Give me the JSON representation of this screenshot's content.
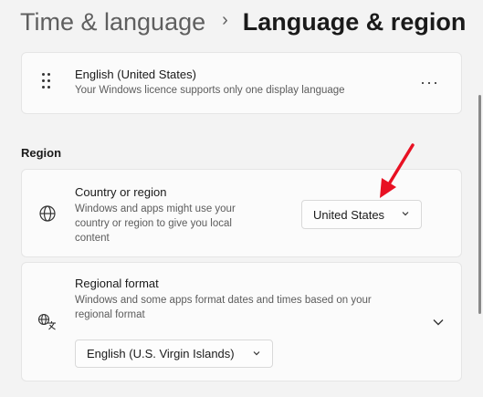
{
  "breadcrumb": {
    "parent": "Time & language",
    "separator": "›",
    "current": "Language & region"
  },
  "language_card": {
    "title": "English (United States)",
    "subtitle": "Your Windows licence supports only one display language",
    "more_label": "···",
    "icon": "drag-handle-icon"
  },
  "region_section": {
    "heading": "Region",
    "country": {
      "title": "Country or region",
      "description_lines": [
        "Windows and apps might use your",
        "country or region to give you local",
        "content"
      ],
      "selected": "United States",
      "icon": "globe-icon"
    },
    "format": {
      "title": "Regional format",
      "description_lines": [
        "Windows and some apps format dates and times based on your",
        "regional format"
      ],
      "selected": "English (U.S. Virgin Islands)",
      "icon": "language-format-icon"
    }
  },
  "annotation": {
    "color": "#e81123"
  }
}
